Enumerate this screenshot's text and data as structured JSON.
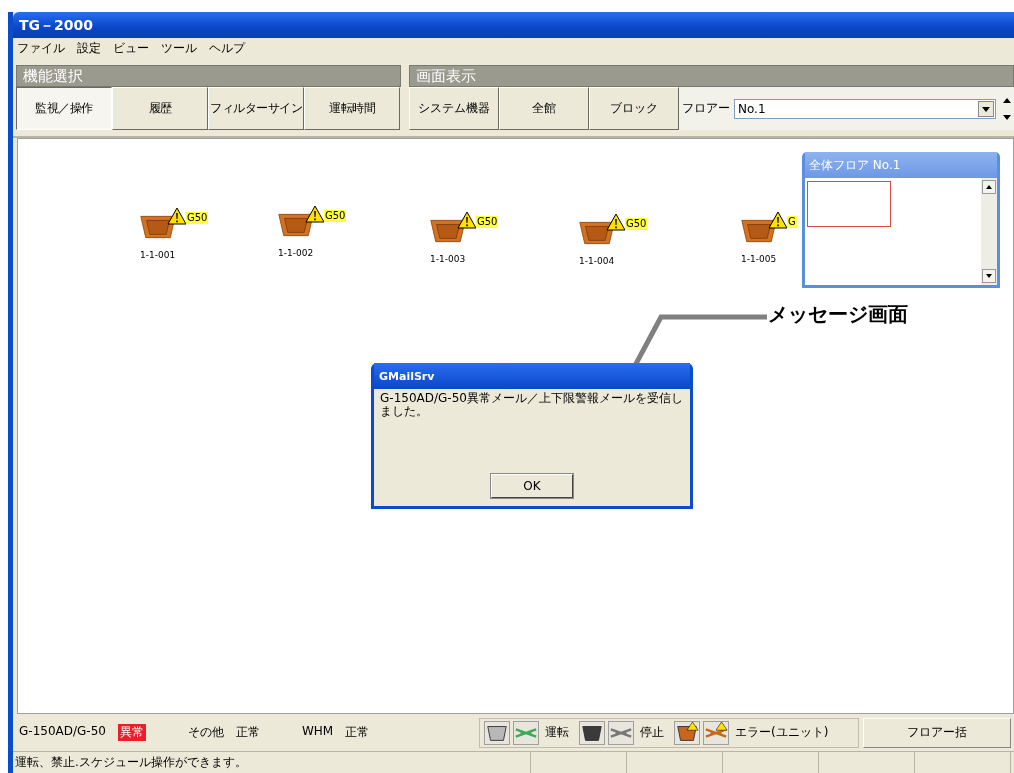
{
  "window": {
    "title": "TG－2000"
  },
  "menu": [
    "ファイル",
    "設定",
    "ビュー",
    "ツール",
    "ヘルプ"
  ],
  "function_panel": {
    "title": "機能選択",
    "buttons": [
      {
        "label": "監視／操作",
        "selected": true
      },
      {
        "label": "履歴",
        "selected": false
      },
      {
        "label": "フィルターサイン",
        "selected": false
      },
      {
        "label": "運転時間",
        "selected": false
      }
    ]
  },
  "display_panel": {
    "title": "画面表示",
    "buttons": [
      {
        "label": "システム機器",
        "selected": false
      },
      {
        "label": "全館",
        "selected": false
      },
      {
        "label": "ブロック",
        "selected": false
      }
    ],
    "floor_label": "フロアー",
    "floor_value": "No.1"
  },
  "units": [
    {
      "label": "1-1-001",
      "alert": true,
      "badge": "G50"
    },
    {
      "label": "1-1-002",
      "alert": true,
      "badge": "G50"
    },
    {
      "label": "1-1-003",
      "alert": true,
      "badge": "G50"
    },
    {
      "label": "1-1-004",
      "alert": true,
      "badge": "G50"
    },
    {
      "label": "1-1-005",
      "alert": true,
      "badge": "G"
    }
  ],
  "overview": {
    "title": "全体フロア No.1"
  },
  "dialog": {
    "title": "GMailSrv",
    "message": "G-150AD/G-50異常メール／上下限警報メールを受信しました。",
    "button": "OK"
  },
  "annotation": "メッセージ画面",
  "status_items": [
    {
      "name": "G-150AD/G-50",
      "value": "異常",
      "alarm": true
    },
    {
      "name": "その他",
      "value": "正常",
      "alarm": false
    },
    {
      "name": "WHM",
      "value": "正常",
      "alarm": false
    }
  ],
  "legend": [
    {
      "kind": "run",
      "label": "運転"
    },
    {
      "kind": "stop",
      "label": "停止"
    },
    {
      "kind": "error",
      "label": "エラー(ユニット)"
    }
  ],
  "floor_all_button": "フロアー括",
  "status_bar": "運転、禁止.スケジュール操作ができます。"
}
